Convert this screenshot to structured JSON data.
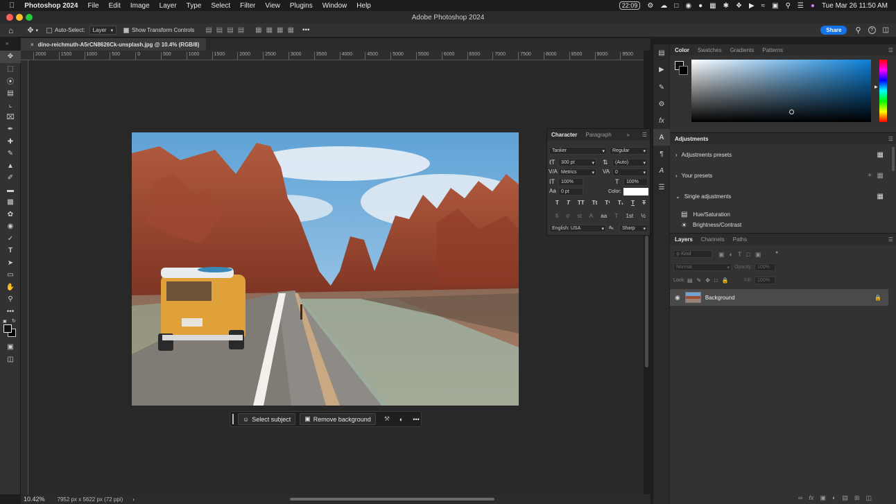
{
  "menubar": {
    "app": "Photoshop 2024",
    "items": [
      "File",
      "Edit",
      "Image",
      "Layer",
      "Type",
      "Select",
      "Filter",
      "View",
      "Plugins",
      "Window",
      "Help"
    ],
    "clock_badge": "22:09",
    "datetime": "Tue Mar 26  11:50 AM"
  },
  "window": {
    "title": "Adobe Photoshop 2024"
  },
  "options": {
    "auto_select_label": "Auto-Select:",
    "layer_select": "Layer",
    "transform_label": "Show Transform Controls",
    "share_label": "Share"
  },
  "document": {
    "tab_title": "dino-reichmuth-A5rCN8626Ck-unsplash.jpg @ 10.4% (RGB/8)"
  },
  "ruler_ticks": [
    "2000",
    "1500",
    "1000",
    "500",
    "0",
    "500",
    "1000",
    "1500",
    "2000",
    "2500",
    "3000",
    "3500",
    "4000",
    "4500",
    "5000",
    "5500",
    "6000",
    "6500",
    "7000",
    "7500",
    "8000",
    "8500",
    "9000",
    "9500",
    "10000"
  ],
  "context_bar": {
    "select_subject": "Select subject",
    "remove_background": "Remove background",
    "more": "•••"
  },
  "character": {
    "tab1": "Character",
    "tab2": "Paragraph",
    "font": "Tanker",
    "style": "Regular",
    "size": "300 pt",
    "leading": "(Auto)",
    "kerning": "Metrics",
    "tracking": "0",
    "vscale": "100%",
    "hscale": "100%",
    "baseline": "0 pt",
    "color_label": "Color:",
    "language": "English: USA",
    "aa_label": "aₐ",
    "aa": "Sharp",
    "styles": [
      "T",
      "T",
      "TT",
      "Tt",
      "T¹",
      "T₁",
      "T",
      "T"
    ],
    "opentype": [
      "fi",
      "σ",
      "st",
      "A",
      "aa",
      "T",
      "1st",
      "½"
    ]
  },
  "status": {
    "zoom": "10.42%",
    "info": "7952 px x 5622 px (72 ppi)"
  },
  "color_panel": {
    "tabs": [
      "Color",
      "Swatches",
      "Gradients",
      "Patterns"
    ]
  },
  "adjustments": {
    "title": "Adjustments",
    "presets": "Adjustments presets",
    "your_presets": "Your presets",
    "single": "Single adjustments",
    "hue": "Hue/Saturation",
    "brightness": "Brightness/Contrast"
  },
  "layers": {
    "tabs": [
      "Layers",
      "Channels",
      "Paths"
    ],
    "kind": "Kind",
    "blend": "Normal",
    "opacity_label": "Opacity:",
    "opacity": "100%",
    "lock_label": "Lock:",
    "fill_label": "Fill:",
    "fill": "100%",
    "layer_name": "Background"
  },
  "colors": {
    "accent": "#1473e6",
    "menubar": "#1c1c1c",
    "panel": "#323232"
  }
}
